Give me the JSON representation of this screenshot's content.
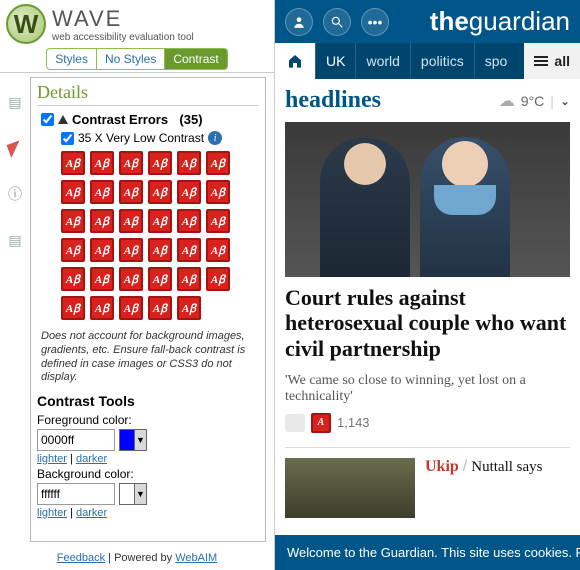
{
  "wave": {
    "logo_letter": "W",
    "title": "WAVE",
    "subtitle": "web accessibility evaluation tool",
    "tabs": {
      "styles": "Styles",
      "nostyles": "No Styles",
      "contrast": "Contrast"
    },
    "details_heading": "Details",
    "errors": {
      "label": "Contrast Errors",
      "count": "(35)"
    },
    "subline": "35 X Very Low Contrast",
    "icon_glyph": "A",
    "icon_count": 35,
    "note": "Does not account for background images, gradients, etc. Ensure fall-back contrast is defined in case images or CSS3 do not display.",
    "tools_heading": "Contrast Tools",
    "fg_label": "Foreground color:",
    "fg_value": "0000ff",
    "fg_swatch": "#0000ff",
    "bg_label": "Background color:",
    "bg_value": "ffffff",
    "bg_swatch": "#ffffff",
    "lighter": "lighter",
    "darker": "darker",
    "sep": " | ",
    "footer": {
      "feedback": "Feedback",
      "mid": " | Powered by ",
      "webaim": "WebAIM"
    }
  },
  "guardian": {
    "brand1": "the",
    "brand2": "guardian",
    "nav": {
      "uk": "UK",
      "world": "world",
      "politics": "politics",
      "sport": "spo",
      "all": "all"
    },
    "section": "headlines",
    "weather": {
      "temp": "9°C"
    },
    "lead": {
      "headline": "Court rules against heterosexual couple who want civil partnership",
      "standfirst": "'We came so close to winning, yet lost on a technicality'",
      "comments": "1,143"
    },
    "second": {
      "kicker": "Ukip",
      "headline": "Nuttall says"
    },
    "cookie": "Welcome to the Guardian. This site uses cookies. Re"
  }
}
